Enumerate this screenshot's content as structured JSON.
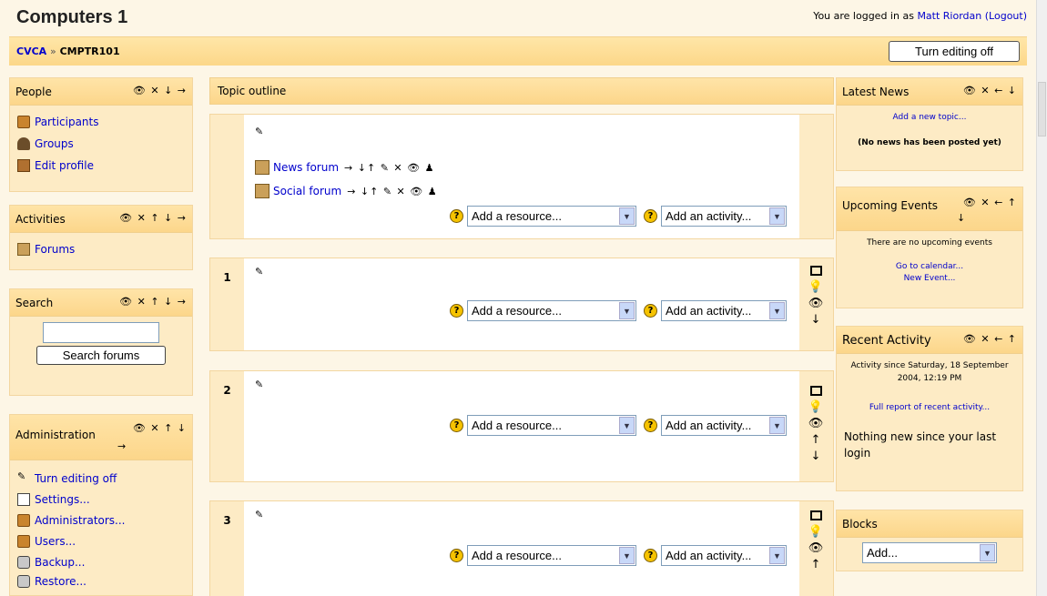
{
  "course": {
    "title": "Computers 1"
  },
  "login": {
    "prefix": "You are logged in as",
    "user": "Matt Riordan",
    "logout": "(Logout)"
  },
  "breadcrumb": {
    "site": "CVCA",
    "sep": "»",
    "course": "CMPTR101"
  },
  "editing_button": "Turn editing off",
  "left": {
    "people": {
      "title": "People",
      "controls": "👁 ✕ ↓ →",
      "items": [
        "Participants",
        "Groups",
        "Edit profile"
      ]
    },
    "activities": {
      "title": "Activities",
      "controls": "👁 ✕ ↑ ↓ →",
      "items": [
        "Forums"
      ]
    },
    "search": {
      "title": "Search",
      "controls": "👁 ✕ ↑ ↓ →",
      "button": "Search forums"
    },
    "admin": {
      "title": "Administration",
      "controls": "👁 ✕ ↑ ↓",
      "controls2": "→",
      "items": [
        "Turn editing off",
        "Settings...",
        "Administrators...",
        "Users...",
        "Backup...",
        "Restore..."
      ]
    }
  },
  "topics": {
    "title": "Topic outline",
    "forums": [
      "News forum",
      "Social forum"
    ],
    "forum_tools": "→ ↓↑ ✎ ✕ 👁 ♟",
    "add_resource": "Add a resource...",
    "add_activity": "Add an activity...",
    "sections": [
      "1",
      "2",
      "3"
    ]
  },
  "right": {
    "news": {
      "title": "Latest News",
      "controls": "👁 ✕ ← ↓",
      "add": "Add a new topic...",
      "empty": "(No news has been posted yet)"
    },
    "events": {
      "title": "Upcoming Events",
      "controls": "👁 ✕ ← ↑",
      "controls2": "↓",
      "empty": "There are no upcoming events",
      "calendar": "Go to calendar...",
      "new_event": "New Event..."
    },
    "recent": {
      "title": "Recent Activity",
      "controls": "👁 ✕ ← ↑",
      "since": "Activity since Saturday, 18 September 2004, 12:19 PM",
      "full": "Full report of recent activity...",
      "nothing": "Nothing new since your last login"
    },
    "blocks": {
      "title": "Blocks",
      "select": "Add..."
    }
  }
}
